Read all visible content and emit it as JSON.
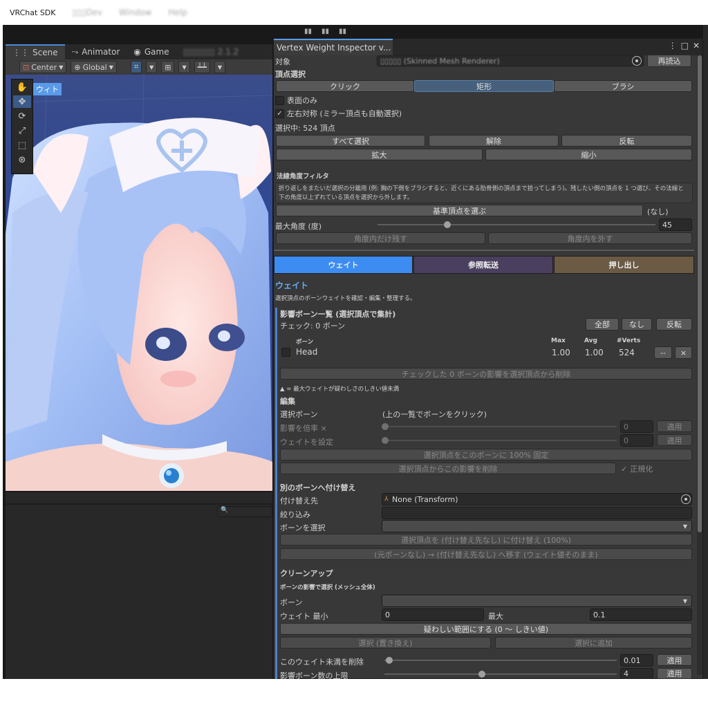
{
  "menubar": {
    "app": "VRChat SDK",
    "blurred_items": [
      "▯▯▯Dev",
      "Window",
      "Help"
    ]
  },
  "scene": {
    "tabs": [
      {
        "label": "Scene",
        "icon": "grid-icon"
      },
      {
        "label": "Animator",
        "icon": "animator-icon"
      },
      {
        "label": "Game",
        "icon": "gamepad-icon"
      },
      {
        "label": "▯▯▯▯▯▯▯ 2.1.2",
        "icon": ""
      }
    ],
    "pivot": "Center",
    "space": "Global",
    "view_label": "ウィト",
    "hierarchy_search_placeholder": ""
  },
  "inspector": {
    "title": "Vertex Weight Inspector v...",
    "target_label": "対象",
    "target_value": "▯▯▯▯▯ (Skinned Mesh Renderer)",
    "reload_button": "再読込",
    "vertex_select_header": "頂点選択",
    "select_modes": [
      "クリック",
      "矩形",
      "ブラシ"
    ],
    "selected_mode_index": 1,
    "surface_only_label": "表面のみ",
    "surface_only_checked": false,
    "mirror_label": "左右対称 (ミラー頂点も自動選択)",
    "mirror_checked": true,
    "selected_count": "選択中: 524 頂点",
    "row1_buttons": [
      "すべて選択",
      "解除",
      "反転"
    ],
    "row2_buttons": [
      "拡大",
      "縮小"
    ],
    "normal_filter": {
      "header": "法線角度フィルタ",
      "help": "折り返しをまたいだ選択の分離用 (例: 胸の下側をブラシすると、近くにある肋骨側の頂点まで拾ってしまう)。残したい側の頂点を 1 つ選び、その法線と下の角度以上ずれている頂点を選択から外します。",
      "pick_button": "基準頂点を選ぶ",
      "pick_status": "(なし)",
      "max_angle_label": "最大角度 (度)",
      "max_angle_value": "45",
      "max_angle_fraction": 0.25,
      "keep_button": "角度内だけ残す",
      "remove_button": "角度内を外す"
    },
    "main_tabs": [
      {
        "label": "ウェイト",
        "color": "#3d8cf2"
      },
      {
        "label": "参照転送",
        "color": "#4a3f5e"
      },
      {
        "label": "押し出し",
        "color": "#6b5a44"
      }
    ],
    "weight": {
      "header": "ウェイト",
      "desc": "選択頂点のボーンウェイトを確認・編集・整理する。",
      "bone_list_header": "影響ボーン一覧 (選択頂点で集計)",
      "checked_count": "チェック: 0 ボーン",
      "list_buttons": [
        "全部",
        "なし",
        "反転"
      ],
      "columns": {
        "bone": "ボーン",
        "max": "Max",
        "avg": "Avg",
        "verts": "#Verts"
      },
      "rows": [
        {
          "bone": "Head",
          "max": "1.00",
          "avg": "1.00",
          "verts": "524",
          "b1": "--",
          "b2": "×"
        }
      ],
      "remove_checked_button": "チェックした 0 ボーンの影響を選択頂点から削除",
      "legend": "▲ = 最大ウェイトが疑わしさのしきい値未満",
      "edit_header": "編集",
      "selected_bone_label": "選択ボーン",
      "selected_bone_value": "(上の一覧でボーンをクリック)",
      "scale_label": "影響を倍率 ×",
      "scale_value": "0",
      "set_label": "ウェイトを設定",
      "set_value": "0",
      "apply": "適用",
      "fix100_button": "選択頂点をこのボーンに 100% 固定",
      "remove_influence_button": "選択頂点からこの影響を削除",
      "normalize_label": "正規化",
      "normalize_checked": true,
      "reassign_header": "別のボーンへ付け替え",
      "reassign_target_label": "付け替え先",
      "reassign_target_value": "None (Transform)",
      "filter_label": "絞り込み",
      "filter_value": "",
      "bone_select_label": "ボーンを選択",
      "reassign_button": "選択頂点を (付け替え先なし) に付け替え (100%)",
      "move_button": "(元ボーンなし) → (付け替え先なし) へ移す (ウェイト値そのまま)",
      "cleanup_header": "クリーンアップ",
      "select_by_bone_header": "ボーンの影響で選択 (メッシュ全体)",
      "bone_label": "ボーン",
      "weight_min_label": "ウェイト 最小",
      "weight_min_value": "0",
      "weight_max_label": "最大",
      "weight_max_value": "0.1",
      "suspicious_button": "疑わしい範囲にする (0 〜 しきい値)",
      "select_replace_button": "選択 (置き換え)",
      "select_add_button": "選択に追加",
      "prune_label": "このウェイト未満を削除",
      "prune_value": "0.01",
      "prune_fraction": 0.02,
      "max_influence_label": "影響ボーン数の上限",
      "max_influence_value": "4",
      "max_influence_fraction": 0.42
    }
  }
}
